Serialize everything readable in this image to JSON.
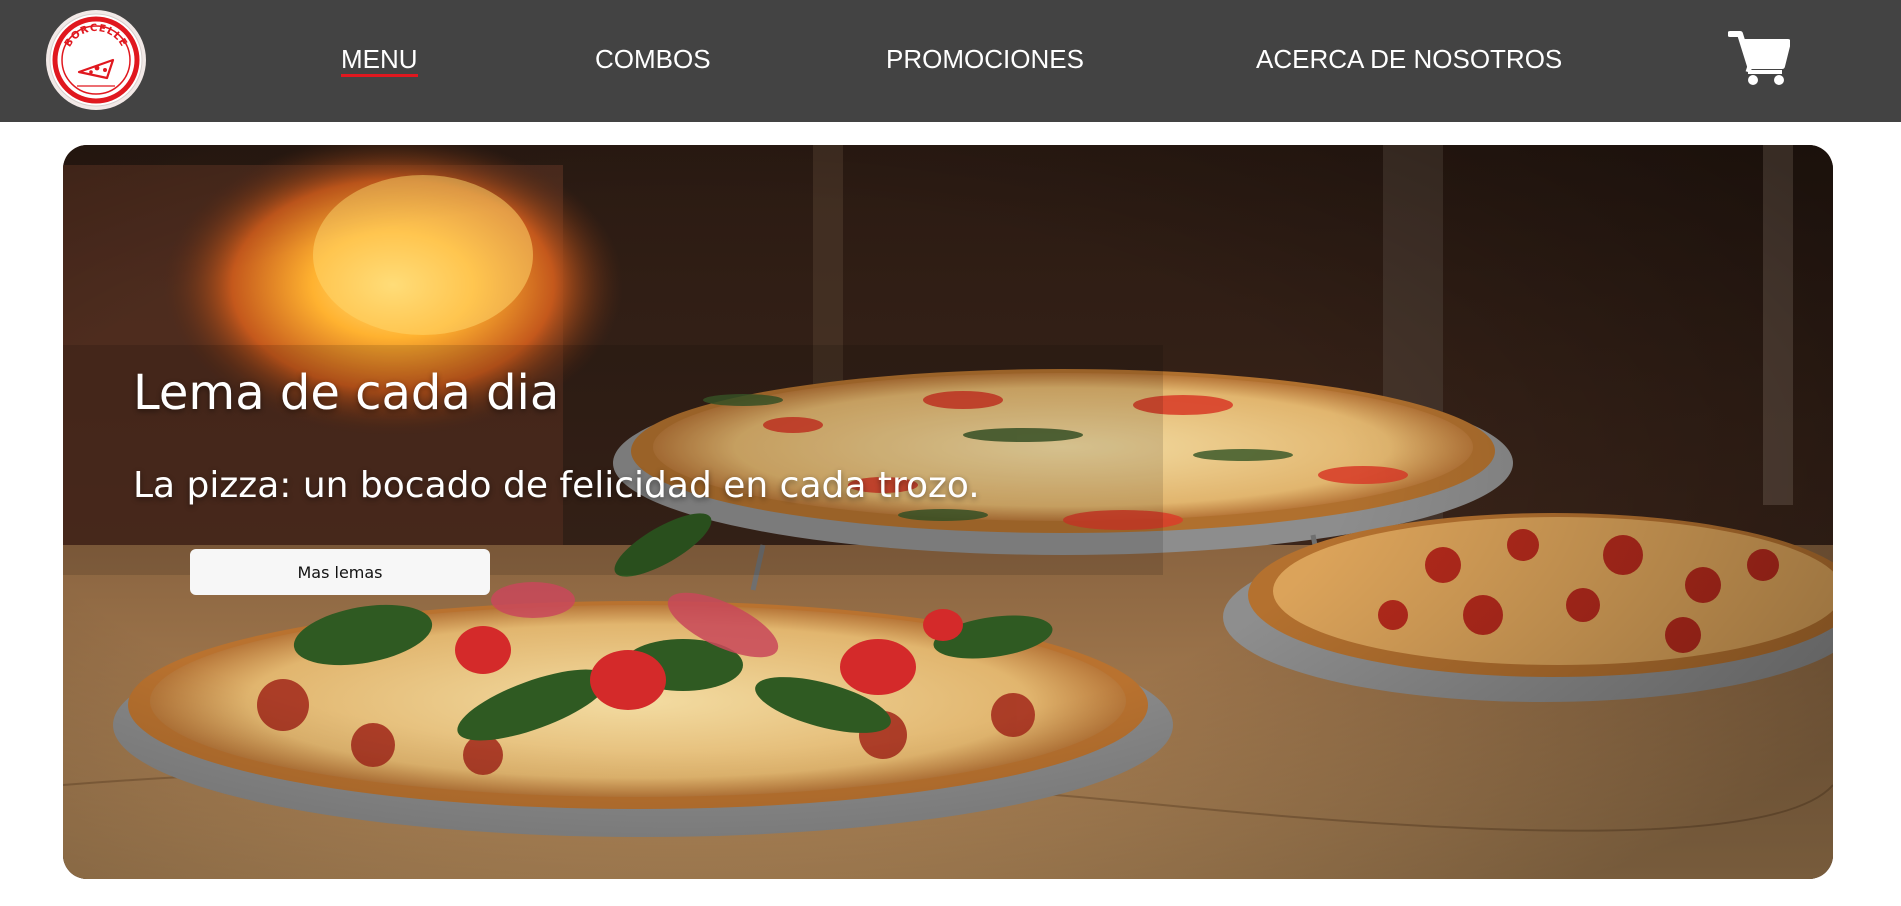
{
  "brand": {
    "logo_text": "BORCELLE",
    "logo_icon": "pizza-slice-icon",
    "accent_color": "#e0181f",
    "navbar_color": "#434343"
  },
  "nav": {
    "items": [
      {
        "label": "MENU",
        "active": true
      },
      {
        "label": "COMBOS",
        "active": false
      },
      {
        "label": "PROMOCIONES",
        "active": false
      },
      {
        "label": "ACERCA DE NOSOTROS",
        "active": false
      }
    ],
    "cart_icon": "shopping-cart-icon"
  },
  "hero": {
    "title": "Lema de cada dia",
    "subtitle": "La pizza: un bocado de felicidad en cada trozo.",
    "button_label": "Mas lemas"
  }
}
